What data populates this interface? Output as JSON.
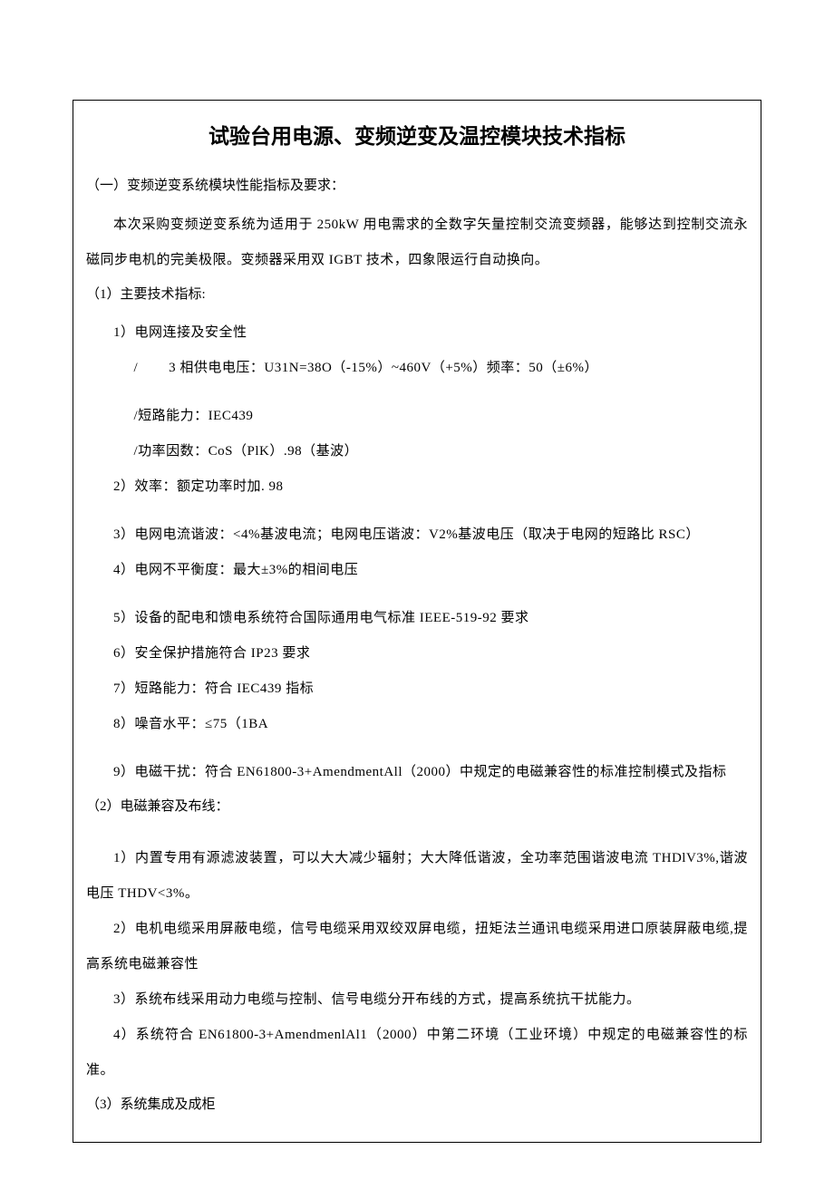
{
  "title": "试验台用电源、变频逆变及温控模块技术指标",
  "section1_heading": "（一）变频逆变系统模块性能指标及要求：",
  "intro": "本次采购变频逆变系统为适用于 250kW 用电需求的全数字矢量控制交流变频器，能够达到控制交流永磁同步电机的完美极限。变频器采用双 IGBT 技术，四象限运行自动换向。",
  "s1_label": "（1）主要技术指标:",
  "s1_1": "1）电网连接及安全性",
  "s1_1_a": "/        3 相供电电压：U31N=38O（-15%）~460V（+5%）频率：50（±6%）",
  "s1_1_b": "/短路能力：IEC439",
  "s1_1_c": "/功率因数：CoS（PlK）.98（基波）",
  "s1_2": "2）效率：额定功率时加. 98",
  "s1_3": "3）电网电流谐波：<4%基波电流；电网电压谐波：V2%基波电压（取决于电网的短路比 RSC）",
  "s1_4": "4）电网不平衡度：最大±3%的相间电压",
  "s1_5": "5）设备的配电和馈电系统符合国际通用电气标准 IEEE-519-92 要求",
  "s1_6": "6）安全保护措施符合 IP23 要求",
  "s1_7": "7）短路能力：符合 IEC439 指标",
  "s1_8": "8）噪音水平：≤75（1BA",
  "s1_9": "9）电磁干扰：符合 EN61800-3+AmendmentAll（2000）中规定的电磁兼容性的标准控制模式及指标",
  "s2_label": "（2）电磁兼容及布线：",
  "s2_1": "1）内置专用有源滤波装置，可以大大减少辐射；大大降低谐波，全功率范围谐波电流 THDlV3%,谐波电压 THDV<3%。",
  "s2_2": "2）电机电缆采用屏蔽电缆，信号电缆采用双绞双屏电缆，扭矩法兰通讯电缆采用进口原装屏蔽电缆,提高系统电磁兼容性",
  "s2_3": "3）系统布线采用动力电缆与控制、信号电缆分开布线的方式，提高系统抗干扰能力。",
  "s2_4": "4）系统符合 EN61800-3+AmendmenlAl1（2000）中第二环境（工业环境）中规定的电磁兼容性的标准。",
  "s3_label": "（3）系统集成及成柜"
}
